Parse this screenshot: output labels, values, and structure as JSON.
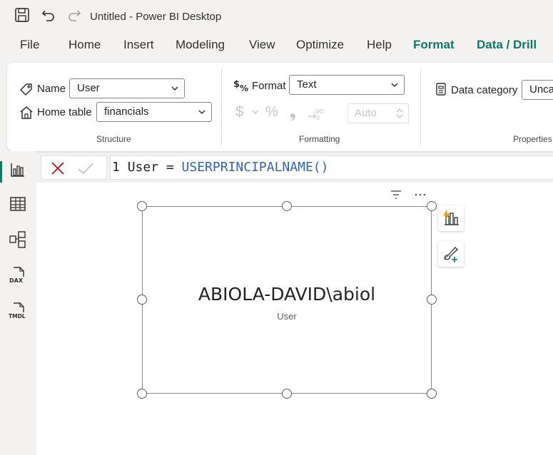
{
  "window": {
    "title": "Untitled - Power BI Desktop"
  },
  "menu": {
    "items": [
      "File",
      "Home",
      "Insert",
      "Modeling",
      "View",
      "Optimize",
      "Help"
    ],
    "context_tabs": [
      "Format",
      "Data / Drill"
    ]
  },
  "ribbon": {
    "structure": {
      "label": "Structure",
      "name_label": "Name",
      "name_value": "User",
      "home_table_label": "Home table",
      "home_table_value": "financials"
    },
    "formatting": {
      "label": "Formatting",
      "format_label": "Format",
      "format_value": "Text",
      "currency_symbol": "$",
      "percent_symbol": "%",
      "comma_symbol": "❟",
      "decimals_value": "Auto"
    },
    "properties": {
      "label": "Properties",
      "data_category_label": "Data category",
      "data_category_value": "Unca"
    }
  },
  "formula": {
    "line_number": "1",
    "text": "User = ",
    "function": "USERPRINCIPALNAME()"
  },
  "visual": {
    "card_value": "ABIOLA-DAVID\\abiol",
    "card_label": "User"
  },
  "colors": {
    "accent": "#117865",
    "function_blue": "#3165b5",
    "cancel_red": "#c50f1f"
  }
}
